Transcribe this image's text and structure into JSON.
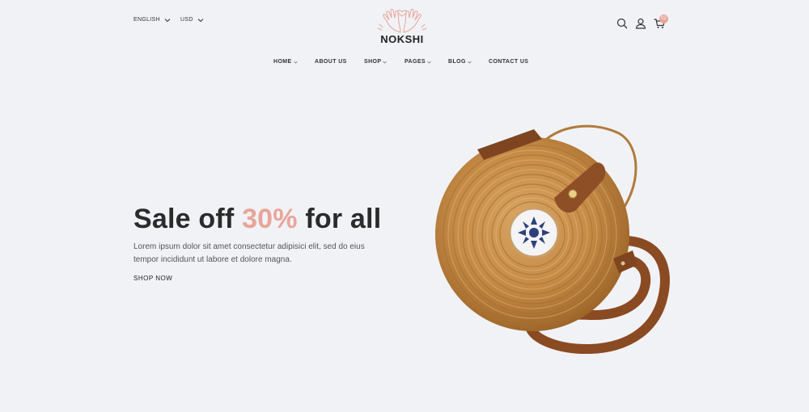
{
  "header": {
    "language": "ENGLISH",
    "currency": "USD",
    "brand": "NOKSHI",
    "cart_count": "02"
  },
  "nav": {
    "items": [
      {
        "label": "HOME",
        "dropdown": true
      },
      {
        "label": "ABOUT US",
        "dropdown": false
      },
      {
        "label": "SHOP",
        "dropdown": true
      },
      {
        "label": "PAGES",
        "dropdown": true
      },
      {
        "label": "BLOG",
        "dropdown": true
      },
      {
        "label": "CONTACT US",
        "dropdown": false
      }
    ]
  },
  "hero": {
    "title_pre": "Sale off ",
    "title_accent": "30%",
    "title_post": " for all",
    "description": "Lorem ipsum dolor sit amet consectetur adipisici elit, sed do eius tempor incididunt ut labore et dolore magna.",
    "cta": "SHOP NOW"
  },
  "icons": [
    "chevron-down-icon",
    "logo-hands-icon",
    "search-icon",
    "user-icon",
    "cart-icon"
  ],
  "colors": {
    "accent": "#e8a598",
    "background": "#f1f2f6",
    "text": "#2b2b2b"
  }
}
